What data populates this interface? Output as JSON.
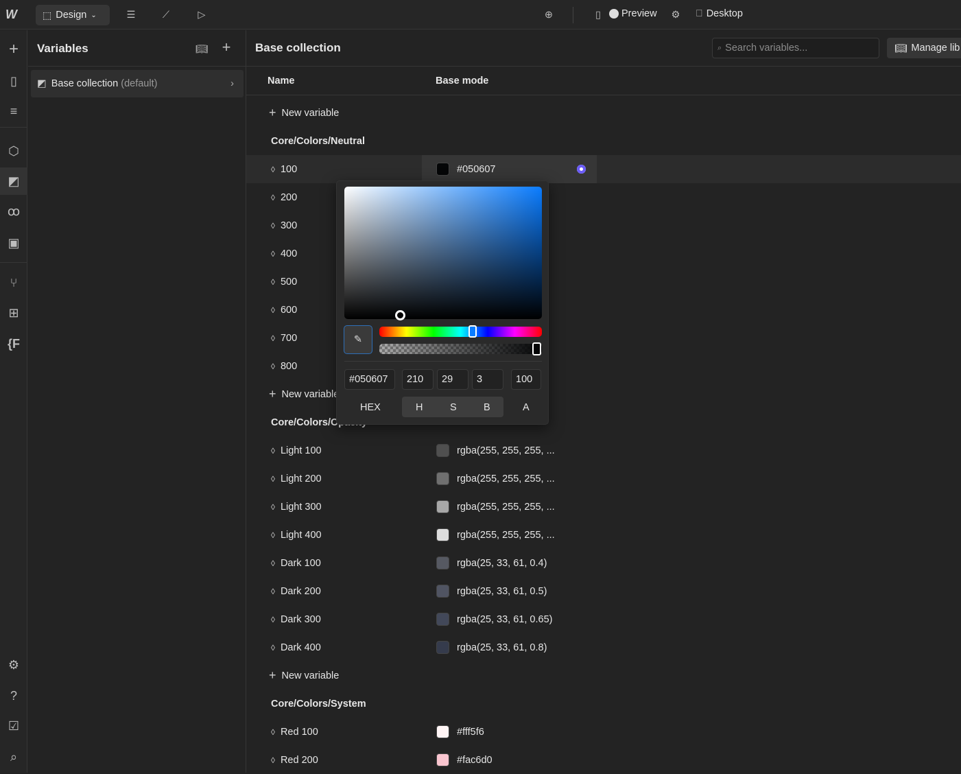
{
  "topbar": {
    "mode": "Design",
    "preview": "Preview",
    "device": "Desktop"
  },
  "sidebar": {
    "title": "Variables",
    "collection_name": "Base collection",
    "collection_tag": "(default)"
  },
  "main": {
    "title": "Base collection",
    "search_placeholder": "Search variables...",
    "manage_label": "Manage lib",
    "col_name": "Name",
    "col_mode": "Base mode",
    "new_variable": "New variable"
  },
  "sections": [
    {
      "group": "Core/Colors/Neutral",
      "vars": [
        {
          "name": "100",
          "value": "#050607",
          "color": "#050607"
        },
        {
          "name": "200"
        },
        {
          "name": "300"
        },
        {
          "name": "400"
        },
        {
          "name": "500"
        },
        {
          "name": "600"
        },
        {
          "name": "700"
        },
        {
          "name": "800"
        }
      ]
    },
    {
      "group": "Core/Colors/Opacity",
      "vars": [
        {
          "name": "Light 100",
          "value": "rgba(255, 255, 255, ...",
          "color": "rgba(255,255,255,0.2)"
        },
        {
          "name": "Light 200",
          "value": "rgba(255, 255, 255, ...",
          "color": "rgba(255,255,255,0.35)"
        },
        {
          "name": "Light 300",
          "value": "rgba(255, 255, 255, ...",
          "color": "rgba(255,255,255,0.6)"
        },
        {
          "name": "Light 400",
          "value": "rgba(255, 255, 255, ...",
          "color": "rgba(255,255,255,0.85)"
        },
        {
          "name": "Dark 100",
          "value": "rgba(25, 33, 61, 0.4)",
          "color": "rgba(120,125,140,0.6)"
        },
        {
          "name": "Dark 200",
          "value": "rgba(25, 33, 61, 0.5)",
          "color": "rgba(100,105,125,0.7)"
        },
        {
          "name": "Dark 300",
          "value": "rgba(25, 33, 61, 0.65)",
          "color": "rgba(70,76,95,0.9)"
        },
        {
          "name": "Dark 400",
          "value": "rgba(25, 33, 61, 0.8)",
          "color": "#353b4c"
        }
      ]
    },
    {
      "group": "Core/Colors/System",
      "vars": [
        {
          "name": "Red 100",
          "value": "#fff5f6",
          "color": "#fff5f6"
        },
        {
          "name": "Red 200",
          "value": "#fac6d0",
          "color": "#fac6d0"
        }
      ]
    }
  ],
  "picker": {
    "hex": "#050607",
    "h": "210",
    "s": "29",
    "b": "3",
    "a": "100",
    "mode_hex": "HEX",
    "mode_h": "H",
    "mode_s": "S",
    "mode_b": "B",
    "mode_a": "A",
    "accent": "#6b5cf6"
  }
}
